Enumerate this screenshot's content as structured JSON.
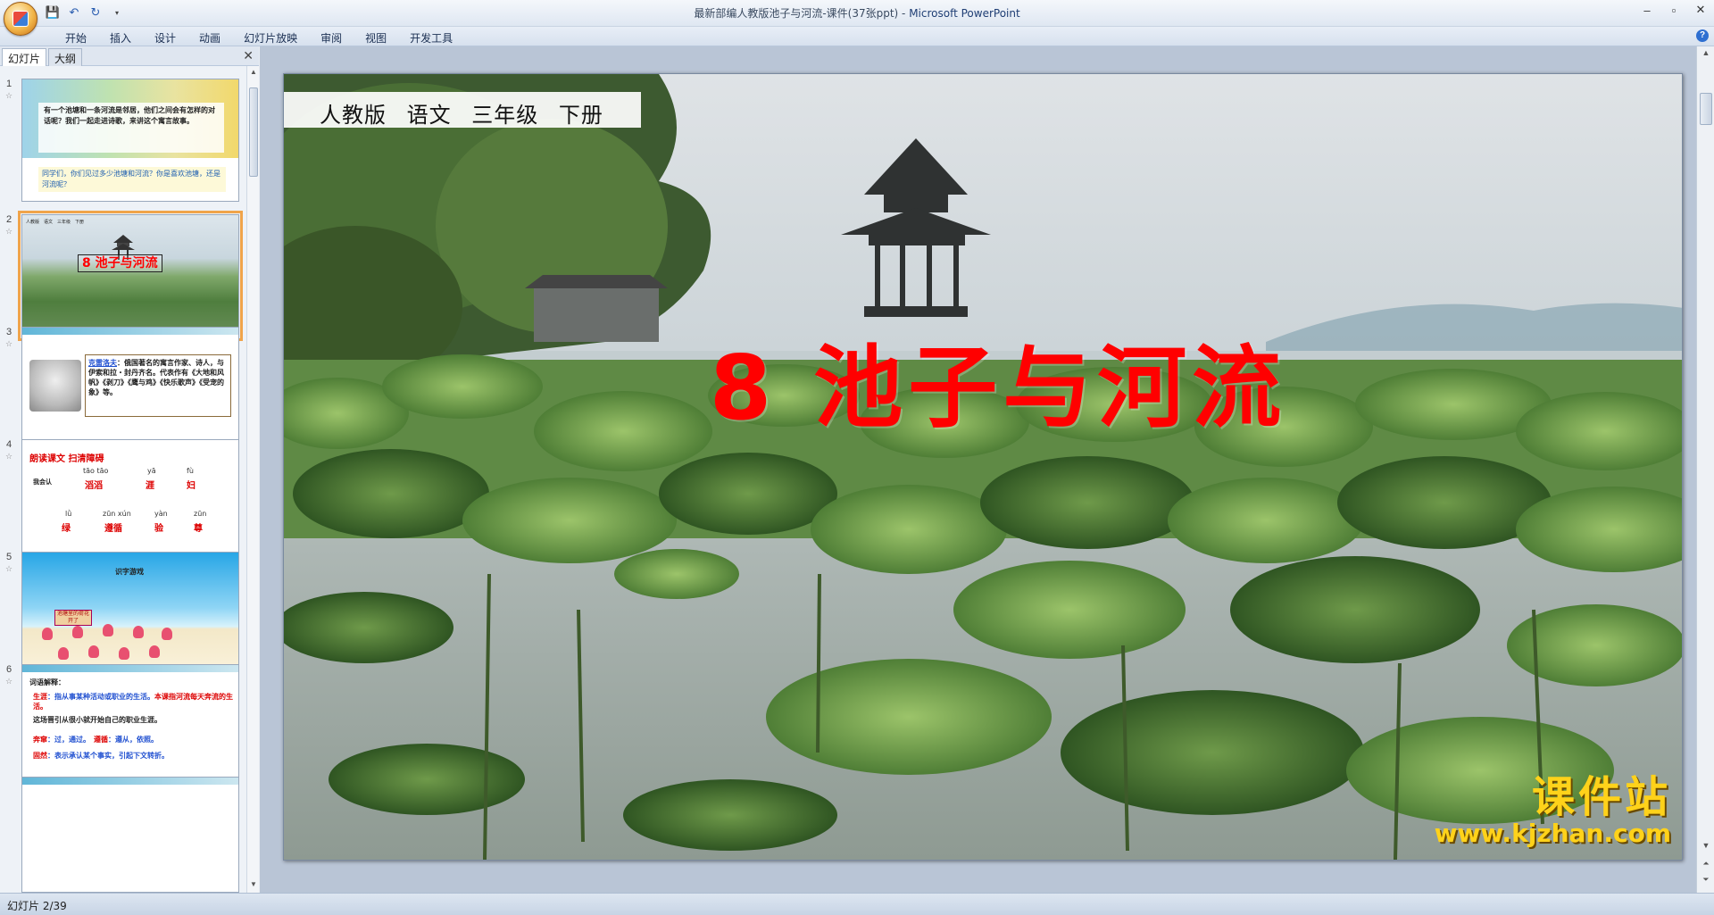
{
  "window": {
    "title_doc": "最新部编人教版池子与河流-课件(37张ppt)",
    "title_sep": " - ",
    "title_app": "Microsoft PowerPoint",
    "controls": [
      "–",
      "▫",
      "✕"
    ]
  },
  "quick_access": [
    "save-icon",
    "undo-icon",
    "redo-icon",
    "customize-icon"
  ],
  "ribbon": {
    "tabs": [
      "开始",
      "插入",
      "设计",
      "动画",
      "幻灯片放映",
      "审阅",
      "视图",
      "开发工具"
    ]
  },
  "panel": {
    "tabs": [
      "幻灯片",
      "大纲"
    ],
    "close": "✕"
  },
  "thumbnails": [
    {
      "num": "1",
      "text_main": "有一个池塘和一条河流是邻居，他们之间会有怎样的对话呢？我们一起走进诗歌，来讲这个寓言故事。",
      "text_question": "同学们，你们见过多少池塘和河流？你是喜欢池塘，还是河流呢？"
    },
    {
      "num": "2",
      "header": "人教版　语文　三年级　下册",
      "title": "8 池子与河流"
    },
    {
      "num": "3",
      "name": "克雷洛夫",
      "text": "：俄国著名的寓言作家、诗人，与伊索和拉・封丹齐名。代表作有《大地和风帆》《剥刀》《鹰与鸡》《快乐歌声》《受宠的象》等。"
    },
    {
      "num": "4",
      "heading": "朗读课文 扫清障碍",
      "label": "我会认",
      "row1": [
        {
          "py": "tāo tāo",
          "ch": "滔滔"
        },
        {
          "py": "yā",
          "ch": "涯"
        },
        {
          "py": "fù",
          "ch": "妇"
        }
      ],
      "row2": [
        {
          "py": "lǜ",
          "ch": "绿"
        },
        {
          "py": "zūn xún",
          "ch": "遵循"
        },
        {
          "py": "yàn",
          "ch": "验"
        },
        {
          "py": "zūn",
          "ch": "尊"
        }
      ]
    },
    {
      "num": "5",
      "title": "识字游戏",
      "sign": "池塘里的荷花开了"
    },
    {
      "num": "6",
      "title": "词语解释：",
      "line1_key": "生涯",
      "line1_text": "：指从事某种活动或职业的生活。",
      "line1_extra": "本课指河流每天奔流的生活。",
      "line2": "这场晋引从很小就开始自己的职业生涯。",
      "line3_key1": "奔窜",
      "line3_text1": "：过，通过。",
      "line3_key2": "遵循",
      "line3_text2": "：遵从，依照。",
      "line4_key": "固然",
      "line4_text": "：表示承认某个事实，引起下文转折。"
    }
  ],
  "slide": {
    "header": "人教版 语文 三年级 下册",
    "title": "8 池子与河流"
  },
  "watermark": {
    "big": "课件站",
    "url": "www.kjzhan.com"
  },
  "status": {
    "slide_info": "幻灯片 2/39"
  },
  "colors": {
    "title_red": "#ff0000",
    "watermark_yellow": "#ffd21a",
    "selection_orange": "#f0a44a"
  }
}
